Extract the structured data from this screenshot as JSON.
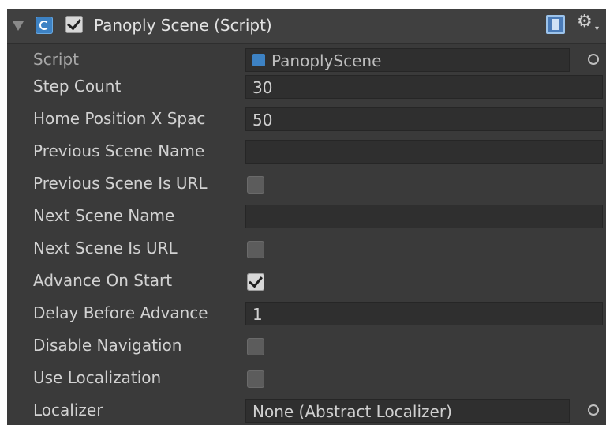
{
  "component": {
    "title": "Panoply Scene (Script)",
    "enabled": true
  },
  "fields": {
    "script": {
      "label": "Script",
      "value": "PanoplyScene"
    },
    "step_count": {
      "label": "Step Count",
      "value": "30"
    },
    "home_position_x": {
      "label": "Home Position X Spac",
      "value": "50"
    },
    "previous_scene_name": {
      "label": "Previous Scene Name",
      "value": ""
    },
    "previous_scene_is_url": {
      "label": "Previous Scene Is URL",
      "checked": false
    },
    "next_scene_name": {
      "label": "Next Scene Name",
      "value": ""
    },
    "next_scene_is_url": {
      "label": "Next Scene Is URL",
      "checked": false
    },
    "advance_on_start": {
      "label": "Advance On Start",
      "checked": true
    },
    "delay_before_advance": {
      "label": "Delay Before Advance",
      "value": "1"
    },
    "disable_navigation": {
      "label": "Disable Navigation",
      "checked": false
    },
    "use_localization": {
      "label": "Use Localization",
      "checked": false
    },
    "localizer": {
      "label": "Localizer",
      "value": "None (Abstract Localizer)"
    }
  },
  "icons": {
    "foldout": "foldout-arrow-icon",
    "script": "script-icon",
    "help": "help-book-icon",
    "settings": "gear-icon",
    "object_picker": "object-picker-icon"
  },
  "colors": {
    "panel_background": "#3a3a3a",
    "field_background": "#2f2f2f",
    "label_text": "#d2d2d2",
    "script_icon": "#3d82c4"
  }
}
